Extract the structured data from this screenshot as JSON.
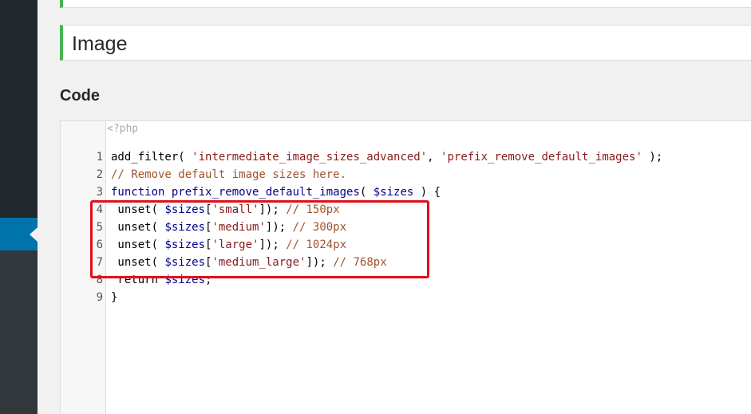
{
  "title_field": {
    "value": "Image"
  },
  "code_section": {
    "heading": "Code",
    "php_open": "<?php",
    "lines": [
      {
        "num": "1",
        "parts": [
          {
            "t": "add_filter( ",
            "c": "plain"
          },
          {
            "t": "'intermediate_image_sizes_advanced'",
            "c": "str"
          },
          {
            "t": ", ",
            "c": "plain"
          },
          {
            "t": "'prefix_remove_default_images'",
            "c": "str"
          },
          {
            "t": " );",
            "c": "plain"
          }
        ]
      },
      {
        "num": "2",
        "parts": [
          {
            "t": "// Remove default image sizes here.",
            "c": "cmt"
          }
        ]
      },
      {
        "num": "3",
        "parts": [
          {
            "t": "function",
            "c": "kw"
          },
          {
            "t": " ",
            "c": "plain"
          },
          {
            "t": "prefix_remove_default_images",
            "c": "kw"
          },
          {
            "t": "( ",
            "c": "plain"
          },
          {
            "t": "$sizes",
            "c": "var"
          },
          {
            "t": " ) {",
            "c": "plain"
          }
        ]
      },
      {
        "num": "4",
        "parts": [
          {
            "t": " unset( ",
            "c": "plain"
          },
          {
            "t": "$sizes",
            "c": "var"
          },
          {
            "t": "[",
            "c": "plain"
          },
          {
            "t": "'small'",
            "c": "str"
          },
          {
            "t": "]); ",
            "c": "plain"
          },
          {
            "t": "// 150px",
            "c": "cmt"
          }
        ]
      },
      {
        "num": "5",
        "parts": [
          {
            "t": " unset( ",
            "c": "plain"
          },
          {
            "t": "$sizes",
            "c": "var"
          },
          {
            "t": "[",
            "c": "plain"
          },
          {
            "t": "'medium'",
            "c": "str"
          },
          {
            "t": "]); ",
            "c": "plain"
          },
          {
            "t": "// 300px",
            "c": "cmt"
          }
        ]
      },
      {
        "num": "6",
        "parts": [
          {
            "t": " unset( ",
            "c": "plain"
          },
          {
            "t": "$sizes",
            "c": "var"
          },
          {
            "t": "[",
            "c": "plain"
          },
          {
            "t": "'large'",
            "c": "str"
          },
          {
            "t": "]); ",
            "c": "plain"
          },
          {
            "t": "// 1024px",
            "c": "cmt"
          }
        ]
      },
      {
        "num": "7",
        "parts": [
          {
            "t": " unset( ",
            "c": "plain"
          },
          {
            "t": "$sizes",
            "c": "var"
          },
          {
            "t": "[",
            "c": "plain"
          },
          {
            "t": "'medium_large'",
            "c": "str"
          },
          {
            "t": "]); ",
            "c": "plain"
          },
          {
            "t": "// 768px",
            "c": "cmt"
          }
        ]
      },
      {
        "num": "8",
        "parts": [
          {
            "t": " return ",
            "c": "plain"
          },
          {
            "t": "$sizes",
            "c": "var"
          },
          {
            "t": ";",
            "c": "plain"
          }
        ]
      },
      {
        "num": "9",
        "parts": [
          {
            "t": "}",
            "c": "plain"
          }
        ]
      }
    ]
  },
  "colors": {
    "sidebar_bg": "#23282d",
    "sidebar_active": "#0073aa",
    "accent_green": "#46b450",
    "highlight_red": "#e0101a"
  }
}
